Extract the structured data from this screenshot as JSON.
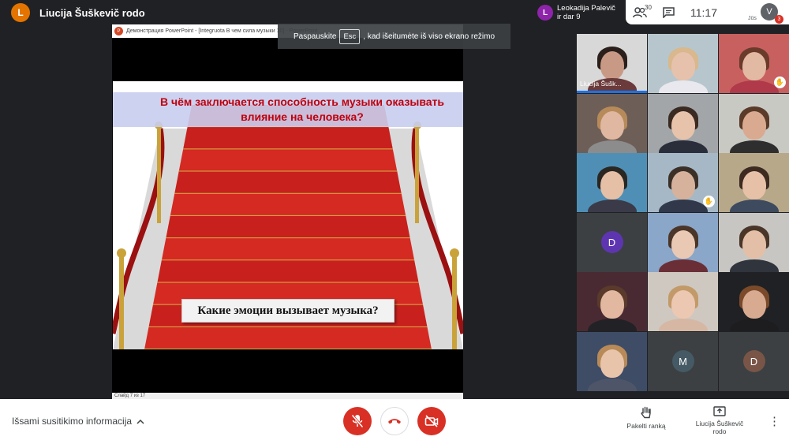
{
  "presenter": {
    "initial": "L",
    "name": "Liucija Šuškevič rodo",
    "color": "#e37400"
  },
  "notification": {
    "initial": "L",
    "text_line1": "Leokadija Palevič",
    "text_line2": "ir dar 9",
    "color": "#8e24aa"
  },
  "top_right": {
    "participants_count": "30",
    "time": "11:17",
    "user_initial": "V",
    "user_label": "Jūs",
    "badge": "3"
  },
  "fullscreen_tip": {
    "before": "Paspauskite",
    "key": "Esc",
    "after": ", kad išeitumėte iš viso ekrano režimo"
  },
  "ppt": {
    "window_title": "Демонстрация PowerPoint - [Integruota В чем сила музыки 10] - PowerPoint",
    "heading": "В чём заключается способность музыки оказывать влияние на человека?",
    "subheading": "Какие эмоции вызывает музыка?",
    "status": "Слайд 7 из 17"
  },
  "tiles": [
    {
      "label": "Liucija Šušk...",
      "kind": "video",
      "bg": "#d8d8d8",
      "skin": "#c89a86",
      "hair": "#2a1f1a",
      "cloth": "#6b3a3a"
    },
    {
      "label": "",
      "kind": "video",
      "bg": "#b7c6cc",
      "skin": "#e6c2ad",
      "hair": "#d8b88c",
      "cloth": "#e8e8ee"
    },
    {
      "label": "",
      "kind": "video",
      "bg": "#c86060",
      "skin": "#e2b9a3",
      "hair": "#6a3b2b",
      "cloth": "#b03a4a",
      "hand": "✋"
    },
    {
      "label": "",
      "kind": "video",
      "bg": "#6e5e58",
      "skin": "#e0b7a0",
      "hair": "#b78a5a",
      "cloth": "#8c8c8c"
    },
    {
      "label": "",
      "kind": "video",
      "bg": "#a2a6a8",
      "skin": "#e7c3ac",
      "hair": "#3a2a22",
      "cloth": "#2a2e3a"
    },
    {
      "label": "",
      "kind": "video",
      "bg": "#c9c9c4",
      "skin": "#d9aa90",
      "hair": "#5a3a28",
      "cloth": "#2e2e2e"
    },
    {
      "label": "",
      "kind": "video",
      "bg": "#4f8fb5",
      "skin": "#e5bfa6",
      "hair": "#2a2622",
      "cloth": "#3a3a48"
    },
    {
      "label": "",
      "kind": "video",
      "bg": "#a6b8c6",
      "skin": "#d6b29c",
      "hair": "#3b3028",
      "cloth": "#31384a",
      "hand": "✋"
    },
    {
      "label": "",
      "kind": "video",
      "bg": "#b8a88a",
      "skin": "#e6c1a7",
      "hair": "#3d2a20",
      "cloth": "#3e4a5e"
    },
    {
      "label": "",
      "kind": "avatar",
      "initial": "D",
      "color": "#5e35b1"
    },
    {
      "label": "",
      "kind": "video",
      "bg": "#8aa6c8",
      "skin": "#e9c9b4",
      "hair": "#4a3528",
      "cloth": "#6a2f36"
    },
    {
      "label": "",
      "kind": "video",
      "bg": "#c8c6c2",
      "skin": "#e3bfa8",
      "hair": "#4a3628",
      "cloth": "#30343c"
    },
    {
      "label": "",
      "kind": "video",
      "bg": "#4a2a32",
      "skin": "#e2b8a0",
      "hair": "#5a3a2a",
      "cloth": "#222226"
    },
    {
      "label": "",
      "kind": "video",
      "bg": "#cfc8c0",
      "skin": "#ecc8b2",
      "hair": "#c29a6a",
      "cloth": "#d6b7a4"
    },
    {
      "label": "",
      "kind": "video",
      "bg": "#202124",
      "skin": "#d8ab90",
      "hair": "#7a4a2a",
      "cloth": "#1d1d1f"
    },
    {
      "label": "",
      "kind": "video",
      "bg": "#3e4c66",
      "skin": "#e8c4ab",
      "hair": "#b88a58",
      "cloth": "#4e5568"
    },
    {
      "label": "",
      "kind": "avatar",
      "initial": "M",
      "color": "#455a64"
    },
    {
      "label": "",
      "kind": "avatar",
      "initial": "D",
      "color": "#795548"
    }
  ],
  "bottom": {
    "details_label": "Išsami susitikimo informacija",
    "raise_hand": "Pakelti ranką",
    "presenting_line1": "Liucija Šuškevič",
    "presenting_line2": "rodo"
  }
}
